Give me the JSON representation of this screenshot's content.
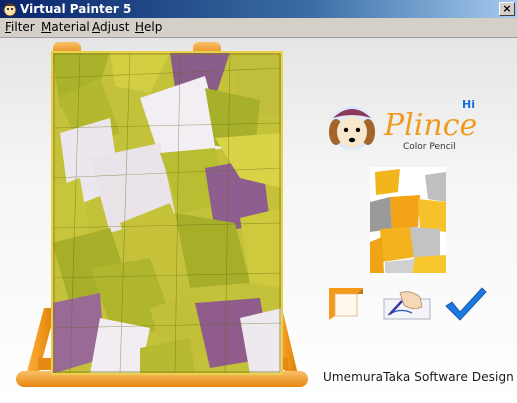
{
  "window": {
    "title": "Virtual Painter 5",
    "close_glyph": "×"
  },
  "menu": [
    {
      "label": "Filter",
      "mnemonic": "F"
    },
    {
      "label": "Material",
      "mnemonic": "M"
    },
    {
      "label": "Adjust",
      "mnemonic": "A"
    },
    {
      "label": "Help",
      "mnemonic": "H"
    }
  ],
  "product": {
    "name": "Plince",
    "subtitle": "Color Pencil",
    "badge": "Hi"
  },
  "footer": {
    "brand": "UmemuraTaka Software Design"
  },
  "colors": {
    "easel": "#f39a1c",
    "title_bar": "#0a246a",
    "checkmark": "#1a7ae0",
    "accent": "#f09a1e"
  },
  "icons": [
    "dog-mascot-icon",
    "frame-icon",
    "hand-drawing-icon",
    "checkmark-icon",
    "painter-app-icon"
  ]
}
